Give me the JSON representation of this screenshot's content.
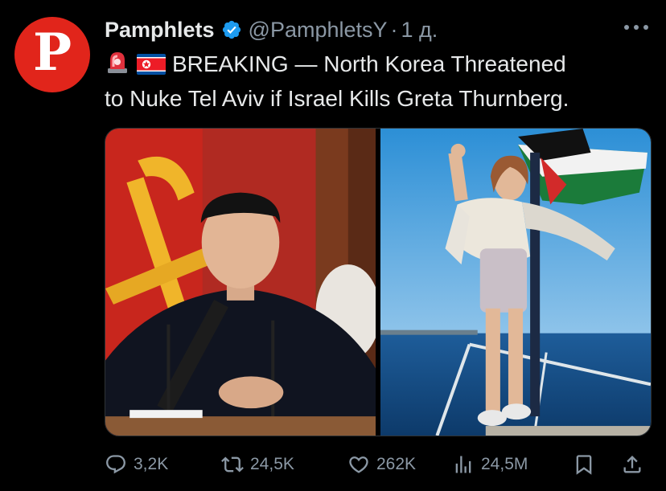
{
  "author": {
    "avatar_letter": "P",
    "name": "Pamphlets",
    "handle": "@PamphletsY",
    "separator": "·",
    "time": "1 д."
  },
  "tweet": {
    "emojis": [
      "rotating-light",
      "north-korea-flag"
    ],
    "line1": "BREAKING — North Korea Threatened",
    "line2": "to Nuke Tel Aviv if Israel Kills Greta Thurnberg."
  },
  "actions": {
    "replies": "3,2K",
    "retweets": "24,5K",
    "likes": "262K",
    "views": "24,5M"
  },
  "colors": {
    "background": "#000000",
    "text": "#e7e9ea",
    "secondary": "#8b98a5",
    "verified": "#1d9bf0",
    "avatar": "#e1251b"
  },
  "icons": [
    "verified-badge-icon",
    "more-icon",
    "reply-icon",
    "retweet-icon",
    "like-icon",
    "views-icon",
    "bookmark-icon",
    "share-icon"
  ]
}
